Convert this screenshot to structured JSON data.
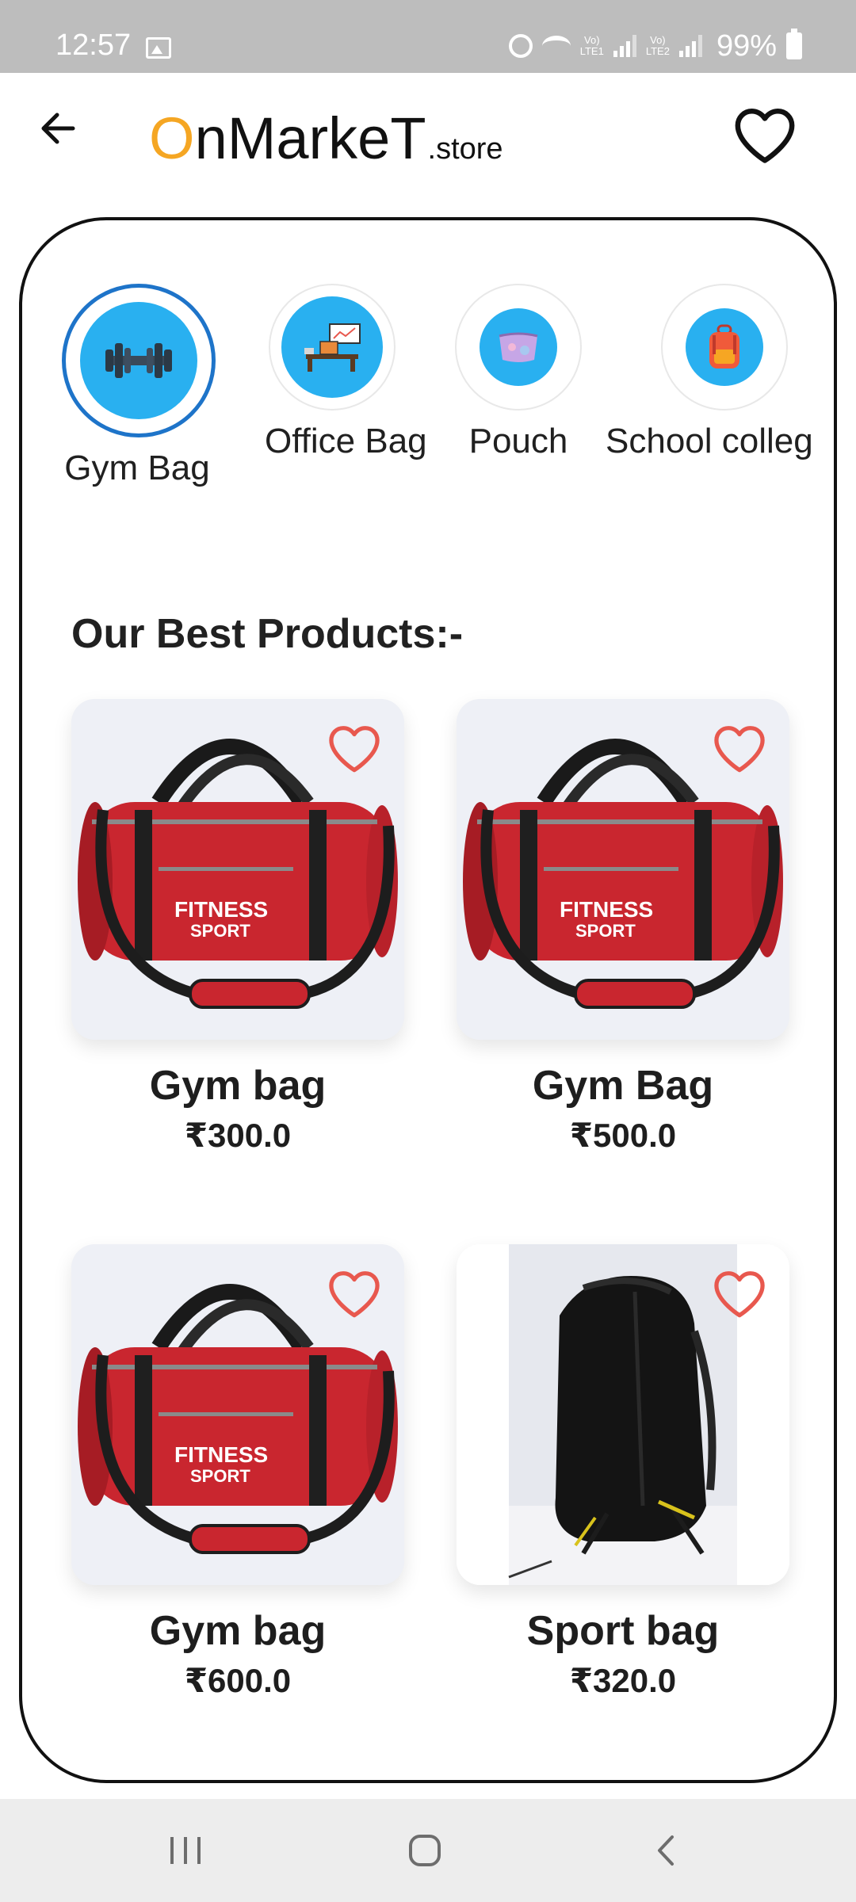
{
  "status_bar": {
    "time": "12:57",
    "sim1_label": "Vo)\nLTE1",
    "sim2_label": "Vo)\nLTE2",
    "battery": "99%"
  },
  "header": {
    "logo_first": "O",
    "logo_rest": "nMarkeT",
    "logo_suffix": ".store",
    "accent_color": "#f5a623"
  },
  "categories": [
    {
      "label": "Gym Bag",
      "icon": "dumbbell-icon",
      "selected": true
    },
    {
      "label": "Office Bag",
      "icon": "office-desk-icon",
      "selected": false
    },
    {
      "label": "Pouch",
      "icon": "pouch-icon",
      "selected": false
    },
    {
      "label": "School colleg",
      "icon": "school-backpack-icon",
      "selected": false
    }
  ],
  "section_title": "Our Best Products:-",
  "products": [
    {
      "name": "Gym bag",
      "price": "₹300.0",
      "image": "red-duffel-bag"
    },
    {
      "name": "Gym Bag",
      "price": "₹500.0",
      "image": "red-duffel-bag"
    },
    {
      "name": "Gym bag",
      "price": "₹600.0",
      "image": "red-duffel-bag"
    },
    {
      "name": "Sport bag",
      "price": "₹320.0",
      "image": "black-backpack"
    }
  ],
  "colors": {
    "category_accent": "#29b0f0",
    "selected_ring": "#1e74c9",
    "favorite_heart": "#e8584e"
  }
}
